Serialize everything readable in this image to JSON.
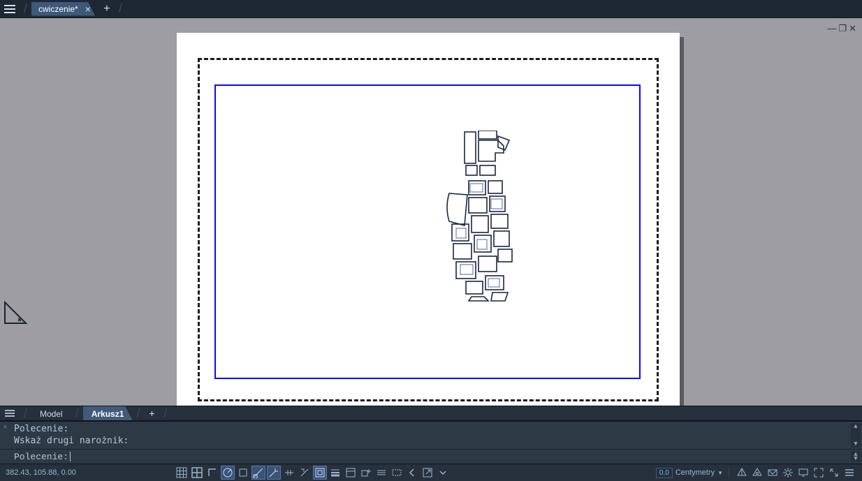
{
  "topbar": {
    "file_tab": "cwiczenie*"
  },
  "sheetbar": {
    "model_tab": "Model",
    "active_sheet": "Arkusz1"
  },
  "command": {
    "history_line1": "Polecenie:",
    "history_line2": "Wskaż drugi narożnik:",
    "prompt": "Polecenie: ",
    "input_value": ""
  },
  "status": {
    "coords": "382.43, 105.88, 0.00",
    "units_code": "0.0",
    "units_label": "Centymetry",
    "tools": [
      {
        "name": "grid-icon",
        "active": false
      },
      {
        "name": "grid-bold-icon",
        "active": false
      },
      {
        "name": "ortho-icon",
        "active": false
      },
      {
        "name": "polar-icon",
        "active": true
      },
      {
        "name": "snap-rect-icon",
        "active": false
      },
      {
        "name": "osnap-icon",
        "active": true
      },
      {
        "name": "tracking-icon",
        "active": true
      },
      {
        "name": "extension-icon",
        "active": false
      },
      {
        "name": "constraint-icon",
        "active": false
      },
      {
        "name": "selection-icon",
        "active": true
      },
      {
        "name": "lineweight-icon",
        "active": false
      },
      {
        "name": "properties-icon",
        "active": false
      },
      {
        "name": "addpoint-icon",
        "active": false
      },
      {
        "name": "hatch-icon",
        "active": false
      },
      {
        "name": "bounds-icon",
        "active": false
      },
      {
        "name": "arrow-left-icon",
        "active": false
      },
      {
        "name": "maximize-viewport-icon",
        "active": false
      },
      {
        "name": "options-icon",
        "active": false
      }
    ],
    "right_tools": [
      {
        "name": "perspective-icon"
      },
      {
        "name": "camera-icon"
      },
      {
        "name": "visual-style-icon"
      },
      {
        "name": "gear-icon"
      },
      {
        "name": "monitor-icon"
      },
      {
        "name": "fullscreen-icon"
      },
      {
        "name": "expand-icon"
      },
      {
        "name": "menu-icon"
      }
    ]
  }
}
